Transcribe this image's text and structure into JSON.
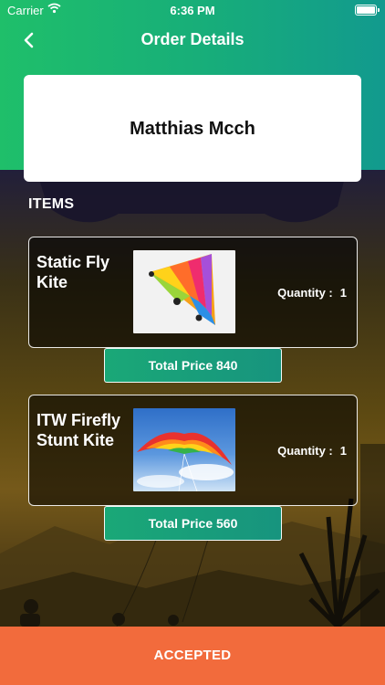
{
  "status_bar": {
    "carrier": "Carrier",
    "time": "6:36 PM",
    "icons": [
      "wifi-icon",
      "battery-icon"
    ]
  },
  "header": {
    "title": "Order Details",
    "back_icon": "chevron-left-icon"
  },
  "customer": {
    "name": "Matthias Mcch"
  },
  "items_section": {
    "heading": "ITEMS",
    "items": [
      {
        "name": "Static Fly Kite",
        "quantity_label": "Quantity :",
        "quantity": "1",
        "total_price": "Total Price 840"
      },
      {
        "name": "ITW Firefly Stunt Kite",
        "quantity_label": "Quantity :",
        "quantity": "1",
        "total_price": "Total Price 560"
      }
    ]
  },
  "footer": {
    "status_button": "ACCEPTED"
  },
  "colors": {
    "header_start": "#1fbf6a",
    "header_end": "#129a8e",
    "accent_button": "#1aa877",
    "footer": "#f26b3c"
  }
}
